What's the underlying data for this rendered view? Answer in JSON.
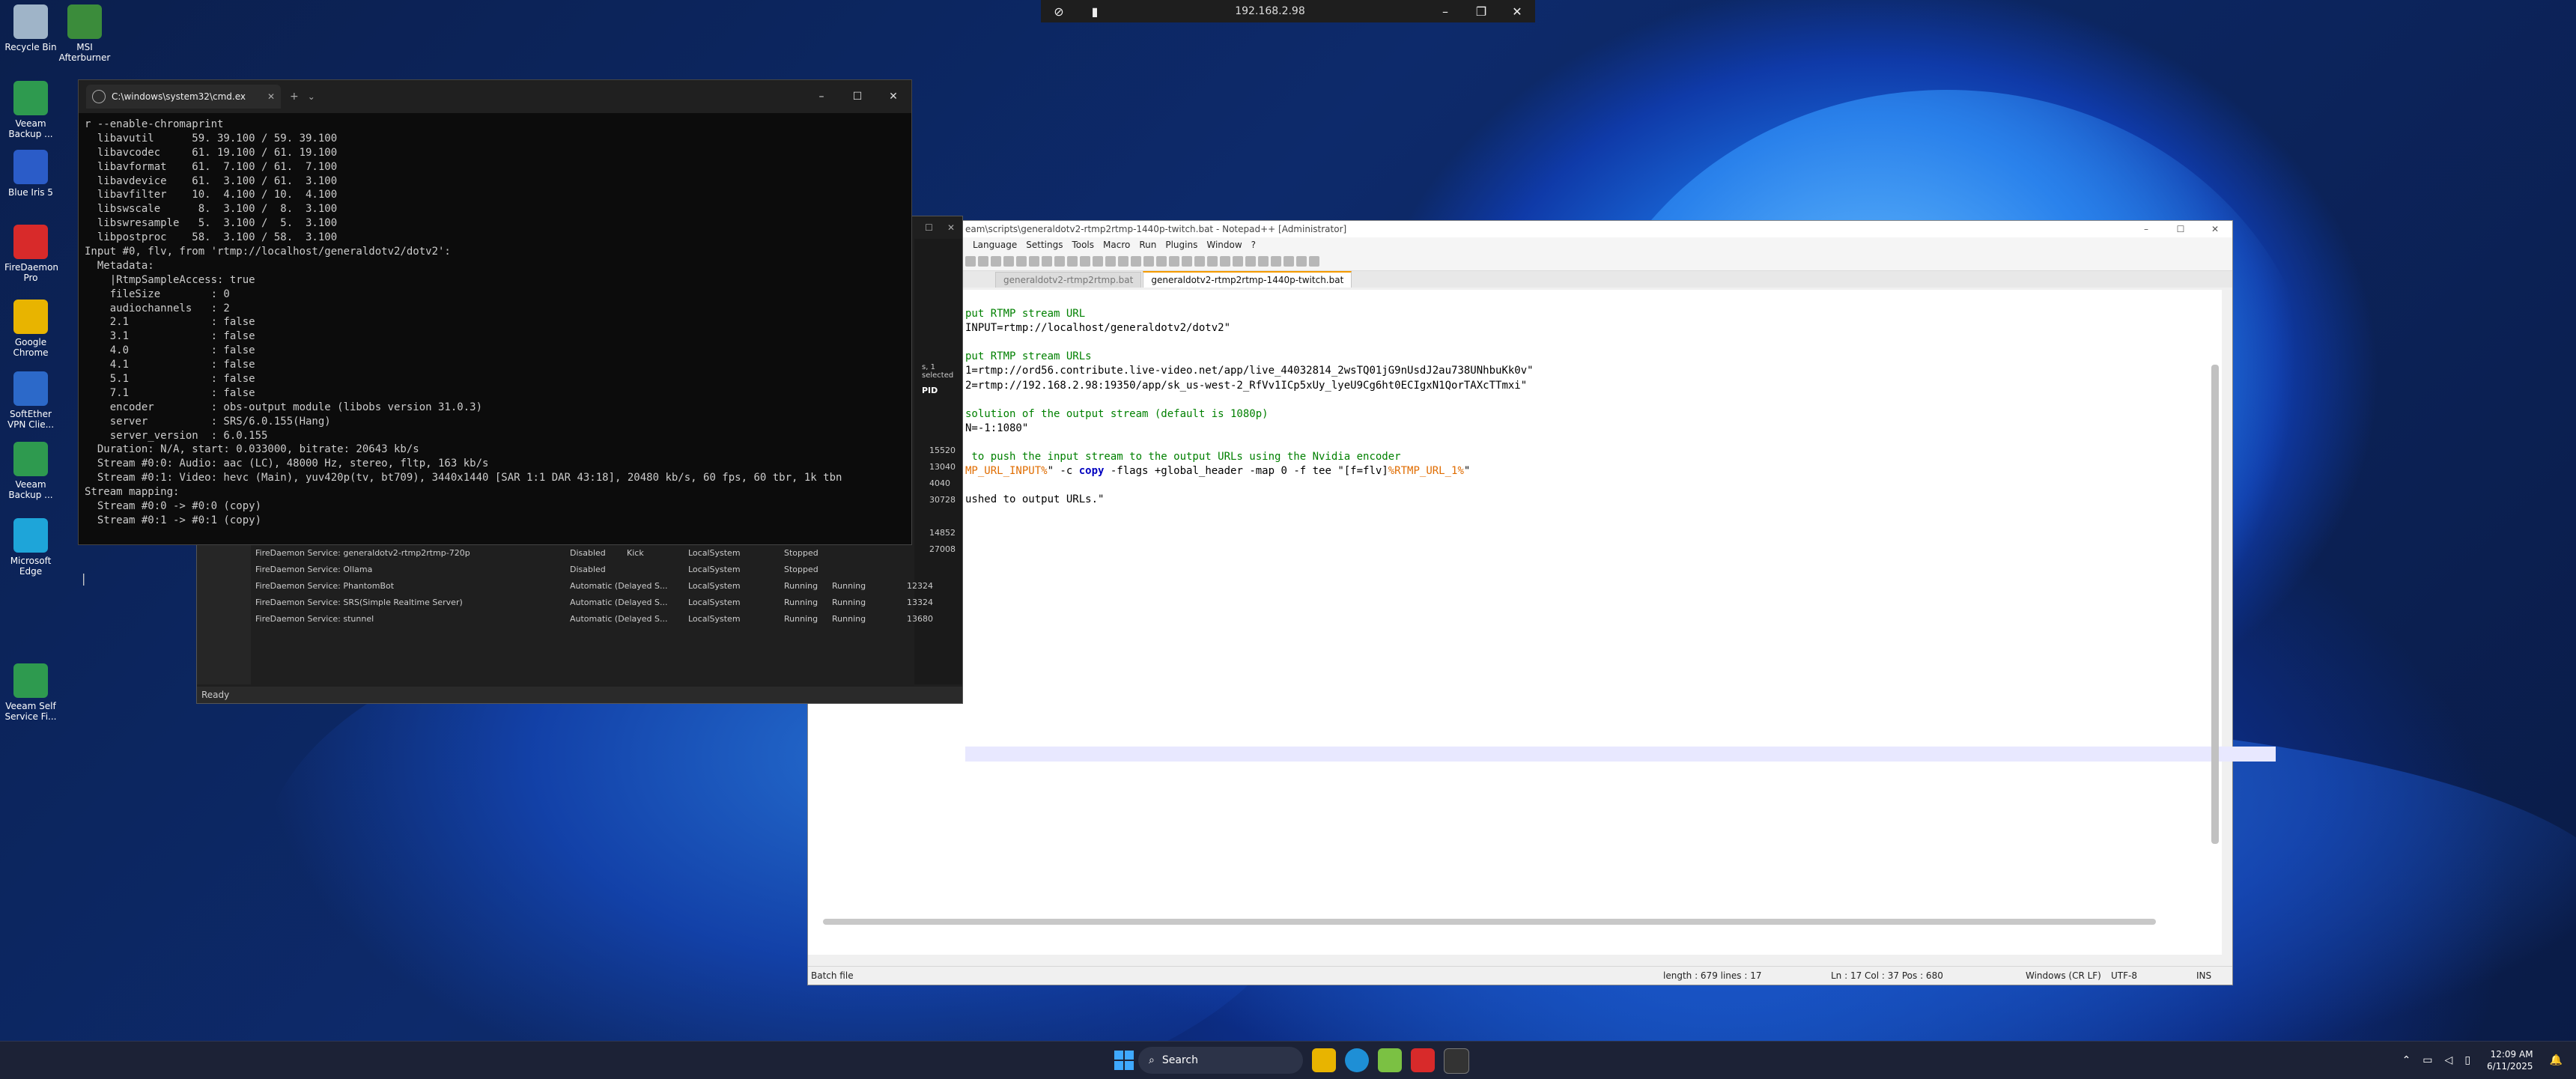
{
  "remote": {
    "title": "192.168.2.98"
  },
  "desktop_icons": [
    {
      "name": "recycle-bin",
      "label": "Recycle Bin",
      "icon": "trash-icon",
      "color": "#9fb4c8"
    },
    {
      "name": "msi-afterburner",
      "label": "MSI Afterburner",
      "icon": "afterburner-icon",
      "color": "#3b8c3b"
    },
    {
      "name": "veeam-backup",
      "label": "Veeam Backup ...",
      "icon": "veeam-icon",
      "color": "#2e9a4f"
    },
    {
      "name": "blue-iris",
      "label": "Blue Iris 5",
      "icon": "eye-icon",
      "color": "#2b5cc8"
    },
    {
      "name": "firedaemon-pro",
      "label": "FireDaemon Pro",
      "icon": "flame-icon",
      "color": "#d82a2a"
    },
    {
      "name": "google-chrome",
      "label": "Google Chrome",
      "icon": "chrome-icon",
      "color": "#e8b400"
    },
    {
      "name": "softether-vpn",
      "label": "SoftEther VPN Clie...",
      "icon": "vpn-icon",
      "color": "#2c69c9"
    },
    {
      "name": "veeam-backup-2",
      "label": "Veeam Backup ...",
      "icon": "veeam-icon",
      "color": "#2e9a4f"
    },
    {
      "name": "microsoft-edge",
      "label": "Microsoft Edge",
      "icon": "edge-icon",
      "color": "#1ea5d9"
    },
    {
      "name": "veeam-self-service",
      "label": "Veeam Self Service Fi...",
      "icon": "veeam-icon",
      "color": "#2e9a4f"
    }
  ],
  "terminal": {
    "tab_title": "C:\\windows\\system32\\cmd.ex",
    "lines": [
      "r --enable-chromaprint",
      "  libavutil      59. 39.100 / 59. 39.100",
      "  libavcodec     61. 19.100 / 61. 19.100",
      "  libavformat    61.  7.100 / 61.  7.100",
      "  libavdevice    61.  3.100 / 61.  3.100",
      "  libavfilter    10.  4.100 / 10.  4.100",
      "  libswscale      8.  3.100 /  8.  3.100",
      "  libswresample   5.  3.100 /  5.  3.100",
      "  libpostproc    58.  3.100 / 58.  3.100",
      "Input #0, flv, from 'rtmp://localhost/generaldotv2/dotv2':",
      "  Metadata:",
      "    |RtmpSampleAccess: true",
      "    fileSize        : 0",
      "    audiochannels   : 2",
      "    2.1             : false",
      "    3.1             : false",
      "    4.0             : false",
      "    4.1             : false",
      "    5.1             : false",
      "    7.1             : false",
      "    encoder         : obs-output module (libobs version 31.0.3)",
      "    server          : SRS/6.0.155(Hang)",
      "    server_version  : 6.0.155",
      "  Duration: N/A, start: 0.033000, bitrate: 20643 kb/s",
      "  Stream #0:0: Audio: aac (LC), 48000 Hz, stereo, fltp, 163 kb/s",
      "  Stream #0:1: Video: hevc (Main), yuv420p(tv, bt709), 3440x1440 [SAR 1:1 DAR 43:18], 20480 kb/s, 60 fps, 60 tbr, 1k tbn",
      "Stream mapping:",
      "  Stream #0:0 -> #0:0 (copy)",
      "  Stream #0:1 -> #0:1 (copy)"
    ],
    "cursor": "|"
  },
  "services": {
    "status": "Ready",
    "selected_info": "s, 1 selected",
    "pid_header": "PID",
    "pids": [
      "15520",
      "13040",
      "4040",
      "30728",
      "14852",
      "27008"
    ],
    "rows": [
      {
        "name": "FireDaemon Service: generaldotv2-rtmp2rtmp-720p",
        "startup": "Disabled",
        "account": "LocalSystem",
        "state": "Stopped",
        "status": "",
        "pid": ""
      },
      {
        "name": "FireDaemon Service: Ollama",
        "startup": "Disabled",
        "account": "LocalSystem",
        "state": "Stopped",
        "status": "",
        "pid": ""
      },
      {
        "name": "FireDaemon Service: PhantomBot",
        "startup": "Automatic (Delayed S...",
        "account": "LocalSystem",
        "state": "Running",
        "status": "Running",
        "pid": "12324"
      },
      {
        "name": "FireDaemon Service: SRS(Simple Realtime Server)",
        "startup": "Automatic (Delayed S...",
        "account": "LocalSystem",
        "state": "Running",
        "status": "Running",
        "pid": "13324"
      },
      {
        "name": "FireDaemon Service: stunnel",
        "startup": "Automatic (Delayed S...",
        "account": "LocalSystem",
        "state": "Running",
        "status": "Running",
        "pid": "13680"
      }
    ],
    "row1_extra": "Kick"
  },
  "notepad": {
    "title": "eam\\scripts\\generaldotv2-rtmp2rtmp-1440p-twitch.bat - Notepad++ [Administrator]",
    "menu": [
      "Language",
      "Settings",
      "Tools",
      "Macro",
      "Run",
      "Plugins",
      "Window",
      "?"
    ],
    "tabs": [
      {
        "label": "generaldotv2-rtmp2rtmp.bat",
        "active": false
      },
      {
        "label": "generaldotv2-rtmp2rtmp-1440p-twitch.bat",
        "active": true
      }
    ],
    "code": [
      {
        "cls": "cmt",
        "text": "put RTMP stream URL"
      },
      {
        "cls": "def",
        "text": "INPUT=rtmp://localhost/generaldotv2/dotv2\""
      },
      {
        "cls": "def",
        "text": ""
      },
      {
        "cls": "cmt",
        "text": "put RTMP stream URLs"
      },
      {
        "cls": "def",
        "text": "1=rtmp://ord56.contribute.live-video.net/app/live_44032814_2wsTQ01jG9nUsdJ2au738UNhbuKk0v\""
      },
      {
        "cls": "def",
        "text": "2=rtmp://192.168.2.98:19350/app/sk_us-west-2_RfVv1ICp5xUy_lyeU9Cg6ht0ECIgxN1QorTAXcTTmxi\""
      },
      {
        "cls": "def",
        "text": ""
      },
      {
        "cls": "cmt",
        "text": "solution of the output stream (default is 1080p)"
      },
      {
        "cls": "def",
        "text": "N=-1:1080\""
      },
      {
        "cls": "def",
        "text": ""
      },
      {
        "cls": "cmt",
        "text": " to push the input stream to the output URLs using the Nvidia encoder"
      },
      {
        "cls": "mix",
        "text": "MP_URL_INPUT%\" -c copy -flags +global_header -map 0 -f tee \"[f=flv]%RTMP_URL_1%\""
      },
      {
        "cls": "def",
        "text": ""
      },
      {
        "cls": "def",
        "text": "ushed to output URLs.\""
      }
    ],
    "status": {
      "type": "Batch file",
      "length": "length : 679    lines : 17",
      "pos": "Ln : 17    Col : 37    Pos : 680",
      "eol": "Windows (CR LF)",
      "enc": "UTF-8",
      "mode": "INS"
    }
  },
  "taskbar": {
    "search_placeholder": "Search",
    "time": "12:09 AM",
    "date": "6/11/2025"
  }
}
